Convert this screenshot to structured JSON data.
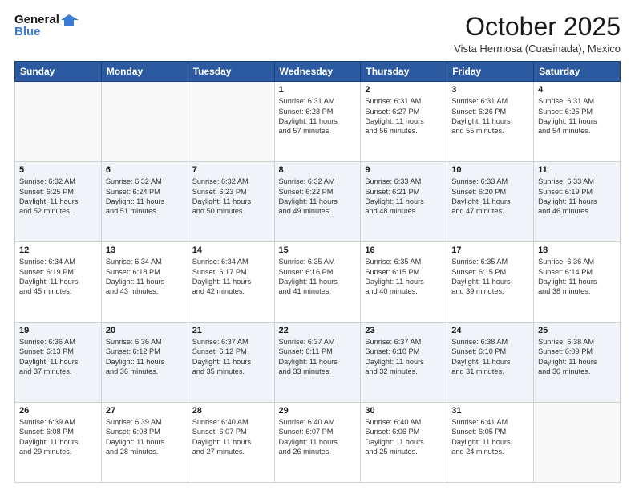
{
  "logo": {
    "line1": "General",
    "line2": "Blue"
  },
  "title": "October 2025",
  "location": "Vista Hermosa (Cuasinada), Mexico",
  "days_of_week": [
    "Sunday",
    "Monday",
    "Tuesday",
    "Wednesday",
    "Thursday",
    "Friday",
    "Saturday"
  ],
  "weeks": [
    [
      {
        "day": "",
        "info": ""
      },
      {
        "day": "",
        "info": ""
      },
      {
        "day": "",
        "info": ""
      },
      {
        "day": "1",
        "sunrise": "6:31 AM",
        "sunset": "6:28 PM",
        "daylight": "11 hours and 57 minutes."
      },
      {
        "day": "2",
        "sunrise": "6:31 AM",
        "sunset": "6:27 PM",
        "daylight": "11 hours and 56 minutes."
      },
      {
        "day": "3",
        "sunrise": "6:31 AM",
        "sunset": "6:26 PM",
        "daylight": "11 hours and 55 minutes."
      },
      {
        "day": "4",
        "sunrise": "6:31 AM",
        "sunset": "6:25 PM",
        "daylight": "11 hours and 54 minutes."
      }
    ],
    [
      {
        "day": "5",
        "sunrise": "6:32 AM",
        "sunset": "6:25 PM",
        "daylight": "11 hours and 52 minutes."
      },
      {
        "day": "6",
        "sunrise": "6:32 AM",
        "sunset": "6:24 PM",
        "daylight": "11 hours and 51 minutes."
      },
      {
        "day": "7",
        "sunrise": "6:32 AM",
        "sunset": "6:23 PM",
        "daylight": "11 hours and 50 minutes."
      },
      {
        "day": "8",
        "sunrise": "6:32 AM",
        "sunset": "6:22 PM",
        "daylight": "11 hours and 49 minutes."
      },
      {
        "day": "9",
        "sunrise": "6:33 AM",
        "sunset": "6:21 PM",
        "daylight": "11 hours and 48 minutes."
      },
      {
        "day": "10",
        "sunrise": "6:33 AM",
        "sunset": "6:20 PM",
        "daylight": "11 hours and 47 minutes."
      },
      {
        "day": "11",
        "sunrise": "6:33 AM",
        "sunset": "6:19 PM",
        "daylight": "11 hours and 46 minutes."
      }
    ],
    [
      {
        "day": "12",
        "sunrise": "6:34 AM",
        "sunset": "6:19 PM",
        "daylight": "11 hours and 45 minutes."
      },
      {
        "day": "13",
        "sunrise": "6:34 AM",
        "sunset": "6:18 PM",
        "daylight": "11 hours and 43 minutes."
      },
      {
        "day": "14",
        "sunrise": "6:34 AM",
        "sunset": "6:17 PM",
        "daylight": "11 hours and 42 minutes."
      },
      {
        "day": "15",
        "sunrise": "6:35 AM",
        "sunset": "6:16 PM",
        "daylight": "11 hours and 41 minutes."
      },
      {
        "day": "16",
        "sunrise": "6:35 AM",
        "sunset": "6:15 PM",
        "daylight": "11 hours and 40 minutes."
      },
      {
        "day": "17",
        "sunrise": "6:35 AM",
        "sunset": "6:15 PM",
        "daylight": "11 hours and 39 minutes."
      },
      {
        "day": "18",
        "sunrise": "6:36 AM",
        "sunset": "6:14 PM",
        "daylight": "11 hours and 38 minutes."
      }
    ],
    [
      {
        "day": "19",
        "sunrise": "6:36 AM",
        "sunset": "6:13 PM",
        "daylight": "11 hours and 37 minutes."
      },
      {
        "day": "20",
        "sunrise": "6:36 AM",
        "sunset": "6:12 PM",
        "daylight": "11 hours and 36 minutes."
      },
      {
        "day": "21",
        "sunrise": "6:37 AM",
        "sunset": "6:12 PM",
        "daylight": "11 hours and 35 minutes."
      },
      {
        "day": "22",
        "sunrise": "6:37 AM",
        "sunset": "6:11 PM",
        "daylight": "11 hours and 33 minutes."
      },
      {
        "day": "23",
        "sunrise": "6:37 AM",
        "sunset": "6:10 PM",
        "daylight": "11 hours and 32 minutes."
      },
      {
        "day": "24",
        "sunrise": "6:38 AM",
        "sunset": "6:10 PM",
        "daylight": "11 hours and 31 minutes."
      },
      {
        "day": "25",
        "sunrise": "6:38 AM",
        "sunset": "6:09 PM",
        "daylight": "11 hours and 30 minutes."
      }
    ],
    [
      {
        "day": "26",
        "sunrise": "6:39 AM",
        "sunset": "6:08 PM",
        "daylight": "11 hours and 29 minutes."
      },
      {
        "day": "27",
        "sunrise": "6:39 AM",
        "sunset": "6:08 PM",
        "daylight": "11 hours and 28 minutes."
      },
      {
        "day": "28",
        "sunrise": "6:40 AM",
        "sunset": "6:07 PM",
        "daylight": "11 hours and 27 minutes."
      },
      {
        "day": "29",
        "sunrise": "6:40 AM",
        "sunset": "6:07 PM",
        "daylight": "11 hours and 26 minutes."
      },
      {
        "day": "30",
        "sunrise": "6:40 AM",
        "sunset": "6:06 PM",
        "daylight": "11 hours and 25 minutes."
      },
      {
        "day": "31",
        "sunrise": "6:41 AM",
        "sunset": "6:05 PM",
        "daylight": "11 hours and 24 minutes."
      },
      {
        "day": "",
        "info": ""
      }
    ]
  ],
  "labels": {
    "sunrise_prefix": "Sunrise: ",
    "sunset_prefix": "Sunset: ",
    "daylight_prefix": "Daylight: "
  }
}
